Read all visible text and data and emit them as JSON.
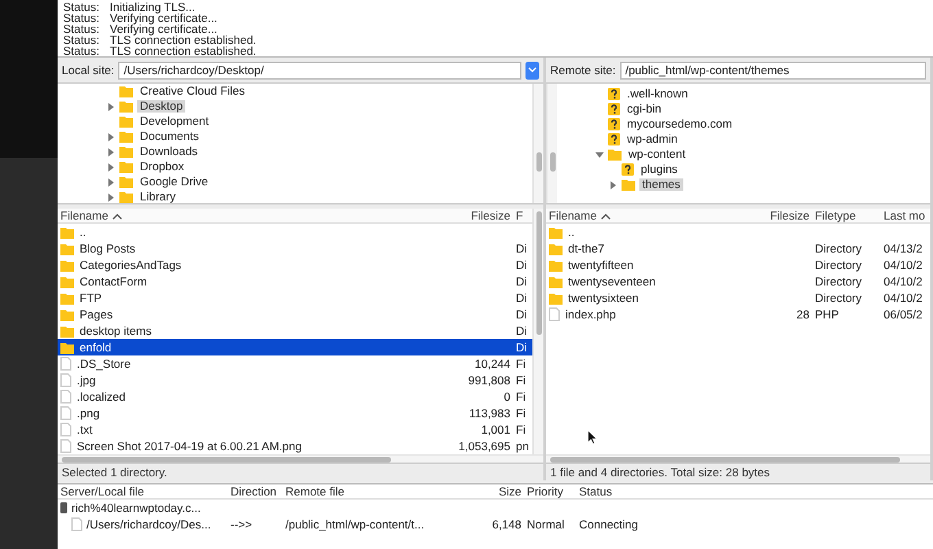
{
  "message_log": [
    {
      "label": "Status:",
      "text": "Initializing TLS..."
    },
    {
      "label": "Status:",
      "text": "Verifying certificate..."
    },
    {
      "label": "Status:",
      "text": "Verifying certificate..."
    },
    {
      "label": "Status:",
      "text": "TLS connection established."
    },
    {
      "label": "Status:",
      "text": "TLS connection established."
    }
  ],
  "local": {
    "site_label": "Local site:",
    "path": "/Users/richardcoy/Desktop/",
    "tree": [
      {
        "label": "Creative Cloud Files",
        "selected": false
      },
      {
        "label": "Desktop",
        "expanded": false,
        "selected": true
      },
      {
        "label": "Development",
        "selected": false
      },
      {
        "label": "Documents",
        "expanded": false,
        "selected": false
      },
      {
        "label": "Downloads",
        "expanded": false,
        "selected": false
      },
      {
        "label": "Dropbox",
        "expanded": false,
        "selected": false
      },
      {
        "label": "Google Drive",
        "expanded": false,
        "selected": false
      },
      {
        "label": "Library",
        "expanded": false,
        "selected": false
      }
    ],
    "columns": [
      "Filename",
      "Filesize",
      "F"
    ],
    "files": [
      {
        "kind": "folder",
        "name": "..",
        "selected": false
      },
      {
        "kind": "folder",
        "name": "Blog Posts",
        "type": "Di",
        "selected": false
      },
      {
        "kind": "folder",
        "name": "CategoriesAndTags",
        "type": "Di",
        "selected": false
      },
      {
        "kind": "folder",
        "name": "ContactForm",
        "type": "Di",
        "selected": false
      },
      {
        "kind": "folder",
        "name": "FTP",
        "type": "Di",
        "selected": false
      },
      {
        "kind": "folder",
        "name": "Pages",
        "type": "Di",
        "selected": false
      },
      {
        "kind": "folder",
        "name": "desktop items",
        "type": "Di",
        "selected": false
      },
      {
        "kind": "folder",
        "name": "enfold",
        "type": "Di",
        "selected": true
      },
      {
        "kind": "file",
        "name": ".DS_Store",
        "size": "10,244",
        "type": "Fi",
        "selected": false
      },
      {
        "kind": "file",
        "name": ".jpg",
        "size": "991,808",
        "type": "Fi",
        "selected": false
      },
      {
        "kind": "file",
        "name": ".localized",
        "size": "0",
        "type": "Fi",
        "selected": false
      },
      {
        "kind": "file",
        "name": ".png",
        "size": "113,983",
        "type": "Fi",
        "selected": false
      },
      {
        "kind": "file",
        "name": ".txt",
        "size": "1,001",
        "type": "Fi",
        "selected": false
      },
      {
        "kind": "file",
        "name": "Screen Shot 2017-04-19 at 6.00.21 AM.png",
        "size": "1,053,695",
        "type": "pn",
        "selected": false
      }
    ],
    "footer": "Selected 1 directory."
  },
  "remote": {
    "site_label": "Remote site:",
    "path": "/public_html/wp-content/themes",
    "tree": [
      {
        "label": ".well-known",
        "kind": "unknown",
        "selected": false
      },
      {
        "label": "cgi-bin",
        "kind": "unknown",
        "selected": false
      },
      {
        "label": "mycoursedemo.com",
        "kind": "unknown",
        "selected": false
      },
      {
        "label": "wp-admin",
        "kind": "unknown",
        "selected": false
      },
      {
        "label": "wp-content",
        "kind": "folder",
        "expanded": true,
        "selected": false,
        "children": [
          {
            "label": "plugins",
            "kind": "unknown",
            "selected": false
          },
          {
            "label": "themes",
            "kind": "folder",
            "expanded": false,
            "selected": true
          }
        ]
      }
    ],
    "columns": [
      "Filename",
      "Filesize",
      "Filetype",
      "Last mo"
    ],
    "files": [
      {
        "kind": "folder",
        "name": ".."
      },
      {
        "kind": "folder",
        "name": "dt-the7",
        "type": "Directory",
        "modified": "04/13/2"
      },
      {
        "kind": "folder",
        "name": "twentyfifteen",
        "type": "Directory",
        "modified": "04/10/2"
      },
      {
        "kind": "folder",
        "name": "twentyseventeen",
        "type": "Directory",
        "modified": "04/10/2"
      },
      {
        "kind": "folder",
        "name": "twentysixteen",
        "type": "Directory",
        "modified": "04/10/2"
      },
      {
        "kind": "file",
        "name": "index.php",
        "size": "28",
        "type": "PHP",
        "modified": "06/05/2"
      }
    ],
    "footer": "1 file and 4 directories. Total size: 28 bytes"
  },
  "queue": {
    "columns": [
      "Server/Local file",
      "Direction",
      "Remote file",
      "Size",
      "Priority",
      "Status"
    ],
    "rows": [
      {
        "kind": "server",
        "local": "rich%40learnwptoday.c..."
      },
      {
        "kind": "file",
        "local": "/Users/richardcoy/Des...",
        "direction": "-->>",
        "remote": "/public_html/wp-content/t...",
        "size": "6,148",
        "priority": "Normal",
        "status": "Connecting"
      }
    ]
  }
}
